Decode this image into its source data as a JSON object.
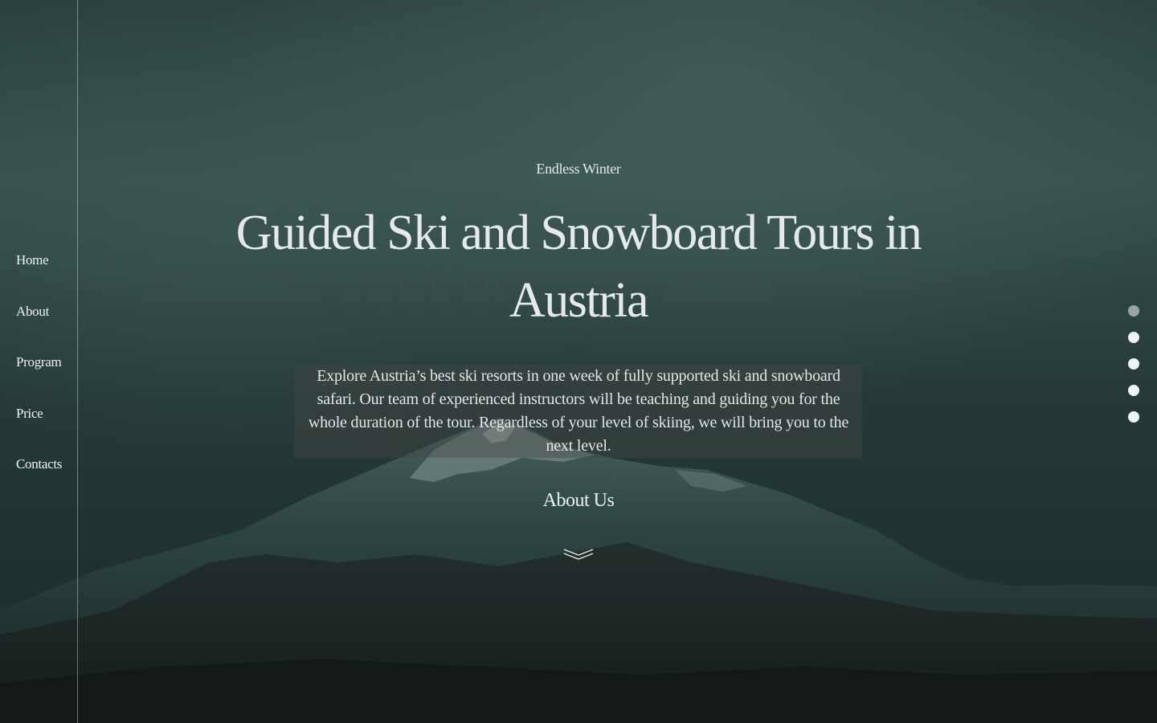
{
  "nav": {
    "items": [
      {
        "label": "Home"
      },
      {
        "label": "About"
      },
      {
        "label": "Program"
      },
      {
        "label": "Price"
      },
      {
        "label": "Contacts"
      }
    ]
  },
  "hero": {
    "eyebrow": "Endless Winter",
    "title": "Guided Ski and Snowboard Tours in Austria",
    "description": "Explore Austria’s best ski resorts in one week of fully supported ski and snowboard safari. Our team of experienced instructors will be teaching and guiding you for the whole duration of the tour. Regardless of your level of skiing, we will bring you to the next level.",
    "about_link": "About Us"
  },
  "pager": {
    "count": 5,
    "active_index": 0
  },
  "colors": {
    "sky_top": "#3d5a55",
    "sky_mid": "#2f4845",
    "mountain_dark": "#1b2322",
    "snow": "#b9c7c4",
    "dot_active": "#9aa6a5",
    "dot": "#f2f4f4"
  }
}
